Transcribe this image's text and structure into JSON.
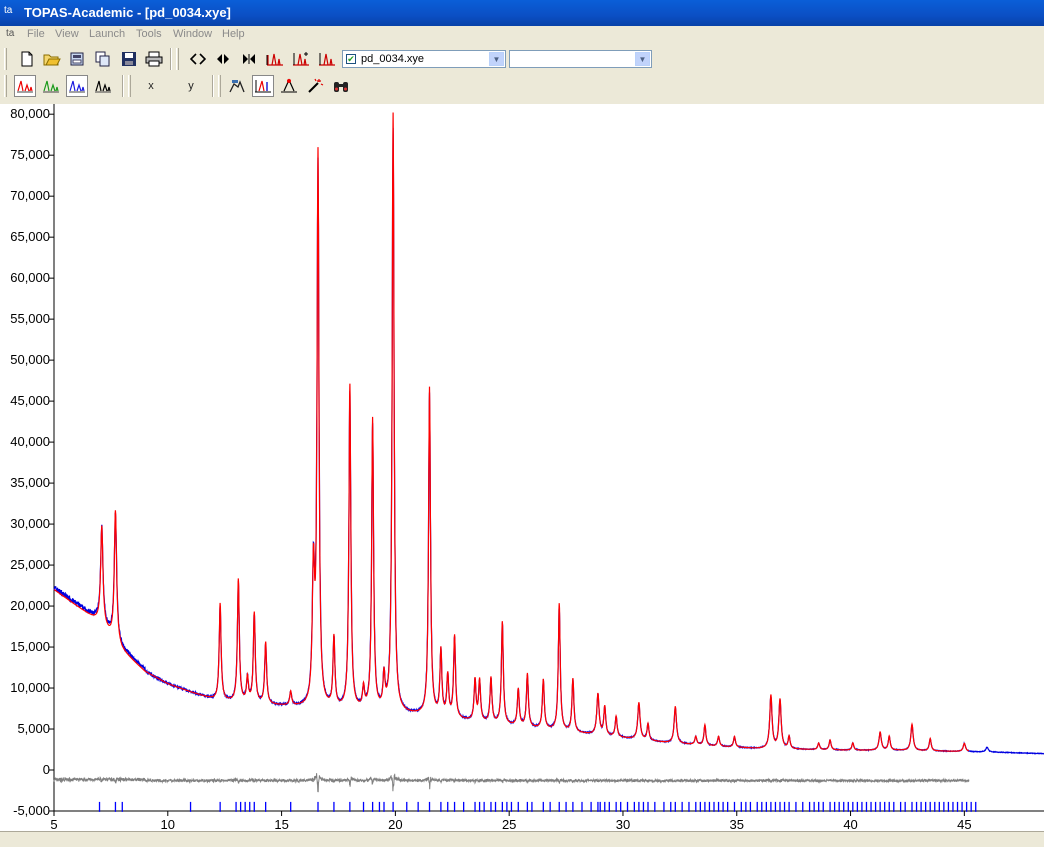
{
  "window": {
    "title": "TOPAS-Academic - [pd_0034.xye]",
    "app_icon": "ta"
  },
  "menu": {
    "doc_icon": "ta",
    "items": [
      "File",
      "View",
      "Launch",
      "Tools",
      "Window",
      "Help"
    ]
  },
  "toolbar1": {
    "buttons": [
      "new-file-icon",
      "open-folder-icon",
      "open-input-icon",
      "copy-input-icon",
      "save-icon",
      "print-icon",
      "zoom-both-icon",
      "zoom-in-x-icon",
      "zoom-out-x-icon",
      "peak-fit-icon",
      "peak-add-icon",
      "peak-remove-icon"
    ],
    "file_combo": {
      "value": "pd_0034.xye",
      "checked": true
    },
    "second_combo": {
      "value": ""
    }
  },
  "toolbar2": {
    "buttons": [
      "pattern-red-icon",
      "pattern-green-icon",
      "pattern-blue-icon",
      "pattern-black-icon"
    ],
    "x_label": "x",
    "y_label": "y",
    "tools": [
      "walker-icon",
      "peak-marker-icon",
      "single-peak-icon",
      "magic-wand-icon",
      "binoculars-icon"
    ]
  },
  "colors": {
    "observed": "#0000e0",
    "calculated": "#ff0000",
    "difference": "#808080",
    "ticks": "#0000ff"
  },
  "chart_data": {
    "type": "line",
    "title": "",
    "xlabel": "",
    "ylabel": "",
    "xlim": [
      5,
      48.5
    ],
    "ylim": [
      -5000,
      81000
    ],
    "x_ticks": [
      "5",
      "10",
      "15",
      "20",
      "25",
      "30",
      "35",
      "40",
      "45"
    ],
    "y_ticks": [
      "80,000",
      "75,000",
      "70,000",
      "65,000",
      "60,000",
      "55,000",
      "50,000",
      "45,000",
      "40,000",
      "35,000",
      "30,000",
      "25,000",
      "20,000",
      "15,000",
      "10,000",
      "5,000",
      "0",
      "-5,000"
    ],
    "grid": false,
    "legend": "none",
    "background_points": [
      [
        5,
        22000
      ],
      [
        6,
        20000
      ],
      [
        7,
        18000
      ],
      [
        8,
        14500
      ],
      [
        9,
        12000
      ],
      [
        10,
        10500
      ],
      [
        11,
        9500
      ],
      [
        12,
        8600
      ],
      [
        13,
        8200
      ],
      [
        14,
        8000
      ],
      [
        16,
        7600
      ],
      [
        18,
        7300
      ],
      [
        20,
        6900
      ],
      [
        22,
        6400
      ],
      [
        24,
        5700
      ],
      [
        26,
        5100
      ],
      [
        28,
        4500
      ],
      [
        30,
        3900
      ],
      [
        32,
        3300
      ],
      [
        34,
        2900
      ],
      [
        36,
        2600
      ],
      [
        38,
        2500
      ],
      [
        40,
        2400
      ],
      [
        42,
        2400
      ],
      [
        44,
        2300
      ],
      [
        46,
        2200
      ],
      [
        48.5,
        2000
      ]
    ],
    "peaks": [
      {
        "x": 7.1,
        "h": 12000,
        "w": 0.06
      },
      {
        "x": 7.7,
        "h": 16000,
        "w": 0.06
      },
      {
        "x": 12.3,
        "h": 11800,
        "w": 0.05
      },
      {
        "x": 13.1,
        "h": 15000,
        "w": 0.05
      },
      {
        "x": 13.5,
        "h": 3000,
        "w": 0.05
      },
      {
        "x": 13.8,
        "h": 11000,
        "w": 0.05
      },
      {
        "x": 14.3,
        "h": 7500,
        "w": 0.05
      },
      {
        "x": 15.4,
        "h": 1700,
        "w": 0.05
      },
      {
        "x": 16.4,
        "h": 16000,
        "w": 0.06
      },
      {
        "x": 16.6,
        "h": 67000,
        "w": 0.05
      },
      {
        "x": 17.3,
        "h": 8500,
        "w": 0.05
      },
      {
        "x": 18.0,
        "h": 39500,
        "w": 0.05
      },
      {
        "x": 18.6,
        "h": 2500,
        "w": 0.05
      },
      {
        "x": 19.0,
        "h": 35500,
        "w": 0.05
      },
      {
        "x": 19.5,
        "h": 4000,
        "w": 0.05
      },
      {
        "x": 19.9,
        "h": 73000,
        "w": 0.05
      },
      {
        "x": 21.5,
        "h": 40000,
        "w": 0.05
      },
      {
        "x": 22.0,
        "h": 8000,
        "w": 0.05
      },
      {
        "x": 22.3,
        "h": 5000,
        "w": 0.05
      },
      {
        "x": 22.6,
        "h": 10000,
        "w": 0.05
      },
      {
        "x": 23.5,
        "h": 5000,
        "w": 0.05
      },
      {
        "x": 23.7,
        "h": 5000,
        "w": 0.05
      },
      {
        "x": 24.2,
        "h": 5500,
        "w": 0.05
      },
      {
        "x": 24.7,
        "h": 12500,
        "w": 0.05
      },
      {
        "x": 25.4,
        "h": 4500,
        "w": 0.05
      },
      {
        "x": 25.8,
        "h": 6500,
        "w": 0.05
      },
      {
        "x": 26.5,
        "h": 6000,
        "w": 0.05
      },
      {
        "x": 27.2,
        "h": 15500,
        "w": 0.05
      },
      {
        "x": 27.8,
        "h": 6500,
        "w": 0.05
      },
      {
        "x": 28.9,
        "h": 5000,
        "w": 0.06
      },
      {
        "x": 29.2,
        "h": 3500,
        "w": 0.05
      },
      {
        "x": 29.7,
        "h": 2500,
        "w": 0.05
      },
      {
        "x": 30.7,
        "h": 4500,
        "w": 0.06
      },
      {
        "x": 31.1,
        "h": 2000,
        "w": 0.05
      },
      {
        "x": 32.3,
        "h": 4500,
        "w": 0.06
      },
      {
        "x": 33.2,
        "h": 1000,
        "w": 0.05
      },
      {
        "x": 33.6,
        "h": 2500,
        "w": 0.05
      },
      {
        "x": 34.2,
        "h": 1200,
        "w": 0.05
      },
      {
        "x": 34.9,
        "h": 1300,
        "w": 0.05
      },
      {
        "x": 36.5,
        "h": 6500,
        "w": 0.06
      },
      {
        "x": 36.9,
        "h": 6000,
        "w": 0.06
      },
      {
        "x": 37.3,
        "h": 1500,
        "w": 0.05
      },
      {
        "x": 38.6,
        "h": 800,
        "w": 0.05
      },
      {
        "x": 39.1,
        "h": 1200,
        "w": 0.05
      },
      {
        "x": 40.1,
        "h": 900,
        "w": 0.05
      },
      {
        "x": 41.3,
        "h": 2200,
        "w": 0.06
      },
      {
        "x": 41.7,
        "h": 1700,
        "w": 0.05
      },
      {
        "x": 42.7,
        "h": 3200,
        "w": 0.06
      },
      {
        "x": 43.5,
        "h": 1500,
        "w": 0.05
      },
      {
        "x": 45.0,
        "h": 1000,
        "w": 0.06
      },
      {
        "x": 46.0,
        "h": 600,
        "w": 0.06
      }
    ],
    "difference_offset": -1300,
    "calc_end_x": 45.2,
    "tick_positions": [
      7.0,
      7.7,
      8.0,
      11.0,
      12.3,
      13.0,
      13.2,
      13.4,
      13.6,
      13.8,
      14.3,
      15.4,
      16.6,
      17.3,
      18.0,
      18.6,
      19.0,
      19.3,
      19.5,
      19.9,
      20.5,
      21.0,
      21.5,
      22.0,
      22.3,
      22.6,
      23.0,
      23.5,
      23.7,
      23.9,
      24.2,
      24.4,
      24.7,
      24.9,
      25.1,
      25.4,
      25.8,
      26.0,
      26.5,
      26.8,
      27.2,
      27.5,
      27.8,
      28.2,
      28.6,
      28.9,
      29.0,
      29.2,
      29.4,
      29.7,
      29.9,
      30.2,
      30.5,
      30.7,
      30.9,
      31.1,
      31.4,
      31.8,
      32.1,
      32.3,
      32.6,
      32.9,
      33.2,
      33.4,
      33.6,
      33.8,
      34.0,
      34.2,
      34.4,
      34.6,
      34.9,
      35.2,
      35.4,
      35.6,
      35.9,
      36.1,
      36.3,
      36.5,
      36.7,
      36.9,
      37.1,
      37.3,
      37.6,
      37.9,
      38.2,
      38.4,
      38.6,
      38.8,
      39.1,
      39.3,
      39.5,
      39.7,
      39.9,
      40.1,
      40.3,
      40.5,
      40.7,
      40.9,
      41.1,
      41.3,
      41.5,
      41.7,
      41.9,
      42.2,
      42.4,
      42.7,
      42.9,
      43.1,
      43.3,
      43.5,
      43.7,
      43.9,
      44.1,
      44.3,
      44.5,
      44.7,
      44.9,
      45.1,
      45.3,
      45.5
    ]
  }
}
